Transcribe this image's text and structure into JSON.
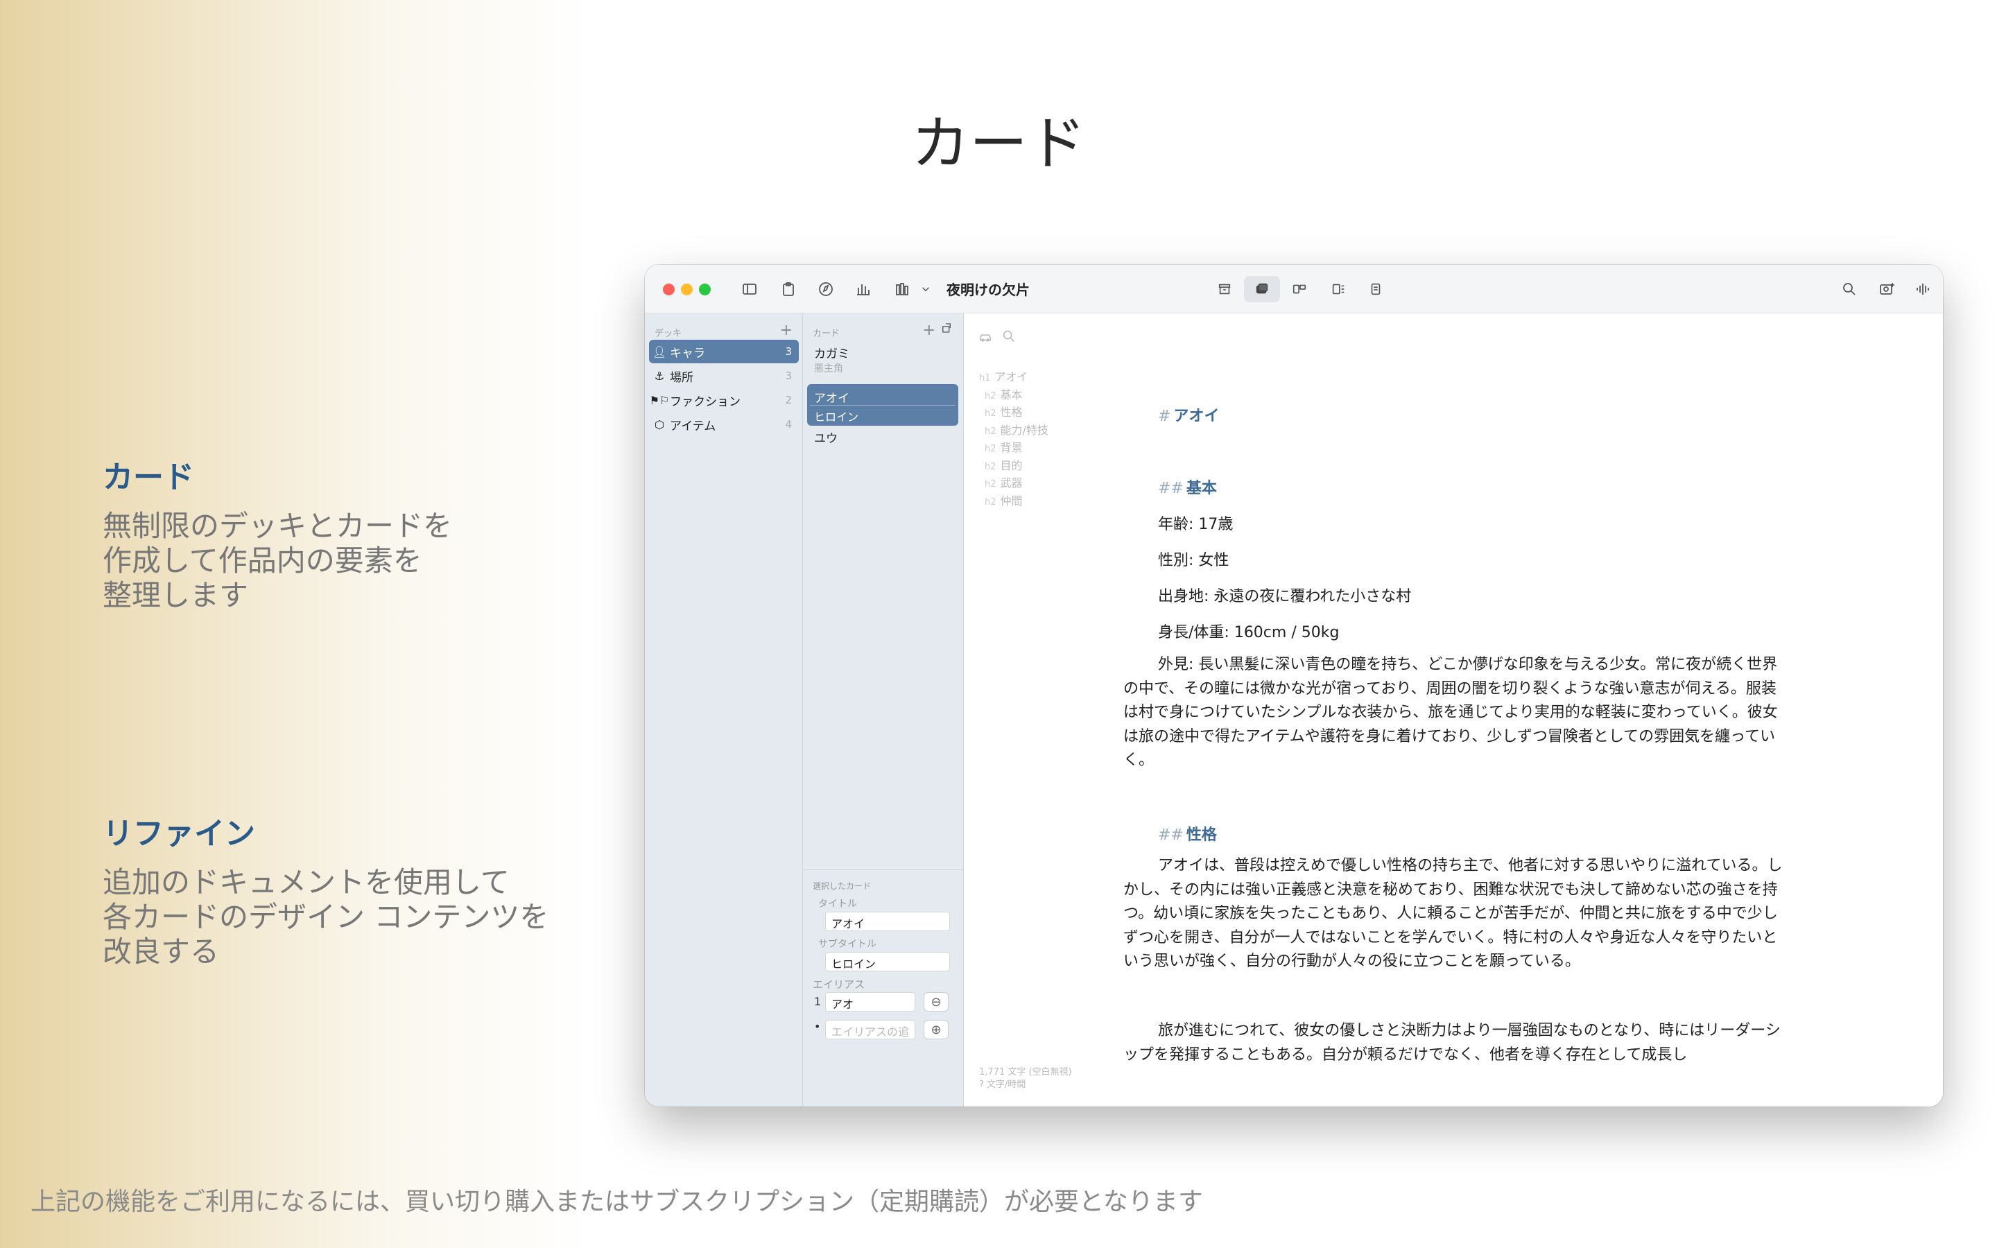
{
  "page": {
    "title": "カード",
    "features": [
      {
        "heading": "カード",
        "body": "無制限のデッキとカードを\n作成して作品内の要素を\n整理します"
      },
      {
        "heading": "リファイン",
        "body": "追加のドキュメントを使用して\n各カードのデザイン コンテンツを\n改良する"
      }
    ],
    "footnote": "上記の機能をご利用になるには、買い切り購入またはサブスクリプション（定期購読）が必要となります"
  },
  "window": {
    "title": "夜明けの欠片"
  },
  "decks": {
    "header": "デッキ",
    "items": [
      {
        "label": "キャラ",
        "count": "3",
        "icon": "person-icon"
      },
      {
        "label": "場所",
        "count": "3",
        "icon": "anchor-icon"
      },
      {
        "label": "ファクション",
        "count": "2",
        "icon": "flags-icon"
      },
      {
        "label": "アイテム",
        "count": "4",
        "icon": "box-icon"
      }
    ]
  },
  "cards": {
    "header": "カード",
    "items": [
      {
        "title": "カガミ",
        "subtitle": "悪主角"
      },
      {
        "title": "アオイ",
        "subtitle": "ヒロイン"
      },
      {
        "title": "ユウ",
        "subtitle": ""
      }
    ]
  },
  "inspector": {
    "header": "選択したカード",
    "title_label": "タイトル",
    "title_value": "アオイ",
    "subtitle_label": "サブタイトル",
    "subtitle_value": "ヒロイン",
    "alias_label": "エイリアス",
    "alias_index": "1",
    "alias_value": "アオ",
    "alias_placeholder": "エイリアスの追",
    "bullet": "•"
  },
  "outline": [
    {
      "level": "h1",
      "text": "アオイ"
    },
    {
      "level": "h2",
      "text": "基本"
    },
    {
      "level": "h2",
      "text": "性格"
    },
    {
      "level": "h2",
      "text": "能力/特技"
    },
    {
      "level": "h2",
      "text": "背景"
    },
    {
      "level": "h2",
      "text": "目的"
    },
    {
      "level": "h2",
      "text": "武器"
    },
    {
      "level": "h2",
      "text": "仲間"
    }
  ],
  "stats": {
    "chars": "1,771 文字 (空白無視)",
    "speed": "? 文字/時間"
  },
  "document": {
    "h1_mark": "#",
    "h1": "アオイ",
    "h2_mark": "##",
    "h2_basic": "基本",
    "age": "年齢: 17歳",
    "gender": "性別: 女性",
    "origin": "出身地: 永遠の夜に覆われた小さな村",
    "height": "身長/体重: 160cm / 50kg",
    "appearance": "外見: 長い黒髪に深い青色の瞳を持ち、どこか儚げな印象を与える少女。常に夜が続く世界の中で、その瞳には微かな光が宿っており、周囲の闇を切り裂くような強い意志が伺える。服装は村で身につけていたシンプルな衣装から、旅を通じてより実用的な軽装に変わっていく。彼女は旅の途中で得たアイテムや護符を身に着けており、少しずつ冒険者としての雰囲気を纏っていく。",
    "h2_personality": "性格",
    "personality": "アオイは、普段は控えめで優しい性格の持ち主で、他者に対する思いやりに溢れている。しかし、その内には強い正義感と決意を秘めており、困難な状況でも決して諦めない芯の強さを持つ。幼い頃に家族を失ったこともあり、人に頼ることが苦手だが、仲間と共に旅をする中で少しずつ心を開き、自分が一人ではないことを学んでいく。特に村の人々や身近な人々を守りたいという思いが強く、自分の行動が人々の役に立つことを願っている。",
    "growth": "旅が進むにつれて、彼女の優しさと決断力はより一層強固なものとなり、時にはリーダーシップを発揮することもある。自分が頼るだけでなく、他者を導く存在として成長し"
  }
}
